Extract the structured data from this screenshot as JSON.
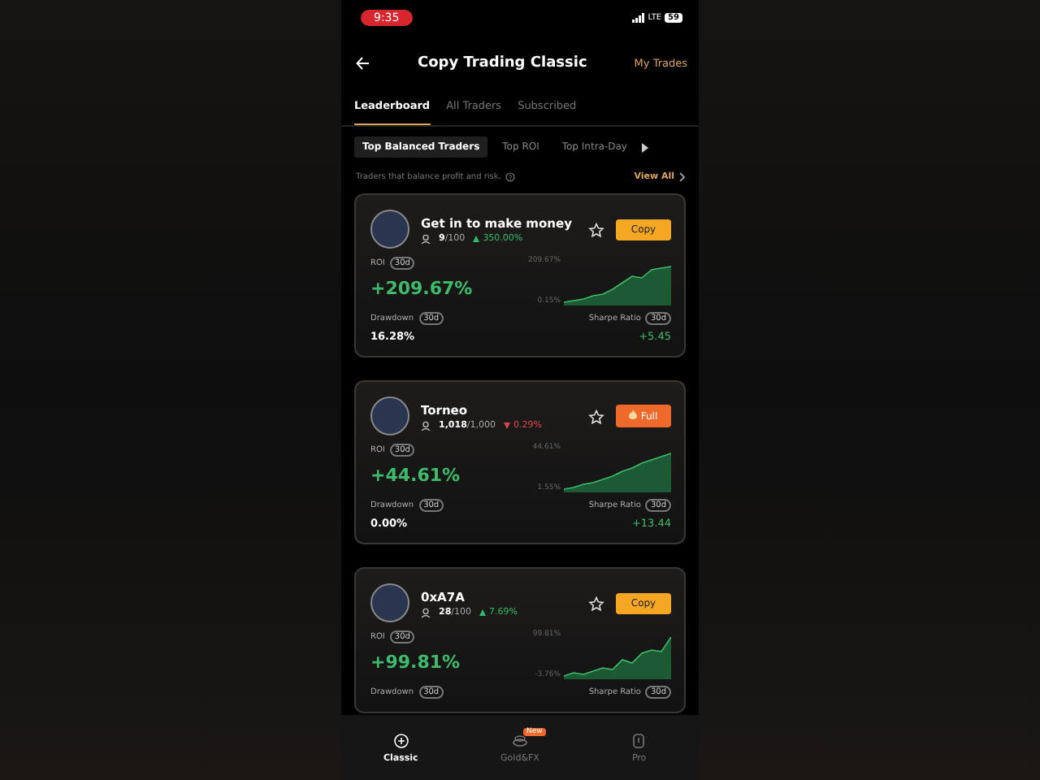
{
  "status_bar": {
    "time": "9:35",
    "network": "LTE",
    "battery": "59"
  },
  "header": {
    "title": "Copy Trading Classic",
    "action": "My Trades"
  },
  "tabs": [
    {
      "label": "Leaderboard",
      "selected": true
    },
    {
      "label": "All Traders",
      "selected": false
    },
    {
      "label": "Subscribed",
      "selected": false
    }
  ],
  "filters": [
    {
      "label": "Top Balanced Traders",
      "selected": true
    },
    {
      "label": "Top ROI",
      "selected": false
    },
    {
      "label": "Top Intra-Day",
      "selected": false
    }
  ],
  "section": {
    "description": "Traders that balance profit and risk.",
    "link": "View All"
  },
  "traders": [
    {
      "name": "Get in to make money",
      "followers": "9",
      "capacity": "/100",
      "change": "350.00%",
      "rising": true,
      "action": {
        "label": "Copy",
        "kind": "copy"
      },
      "roi_label": "ROI",
      "roi_period": "30d",
      "roi": "+209.67%",
      "chart_max": "209.67%",
      "chart_min": "0.15%",
      "drawdown_label": "Drawdown",
      "drawdown_period": "30d",
      "drawdown": "16.28%",
      "sharpe_label": "Sharpe Ratio",
      "sharpe_period": "30d",
      "sharpe": "+5.45"
    },
    {
      "name": "Torneo",
      "followers": "1,018",
      "capacity": "/1,000",
      "change": "0.29%",
      "rising": false,
      "action": {
        "label": "Full",
        "kind": "full"
      },
      "roi_label": "ROI",
      "roi_period": "30d",
      "roi": "+44.61%",
      "chart_max": "44.61%",
      "chart_min": "1.55%",
      "drawdown_label": "Drawdown",
      "drawdown_period": "30d",
      "drawdown": "0.00%",
      "sharpe_label": "Sharpe Ratio",
      "sharpe_period": "30d",
      "sharpe": "+13.44"
    },
    {
      "name": "0xA7A",
      "followers": "28",
      "capacity": "/100",
      "change": "7.69%",
      "rising": true,
      "action": {
        "label": "Copy",
        "kind": "copy"
      },
      "roi_label": "ROI",
      "roi_period": "30d",
      "roi": "+99.81%",
      "chart_max": "99.81%",
      "chart_min": "-3.76%",
      "drawdown_label": "Drawdown",
      "drawdown_period": "30d",
      "sharpe_label": "Sharpe Ratio",
      "sharpe_period": "30d"
    }
  ],
  "bottom_nav": [
    {
      "label": "Classic",
      "selected": true
    },
    {
      "label": "Gold&FX",
      "selected": false,
      "badge": "New"
    },
    {
      "label": "Pro",
      "selected": false
    }
  ]
}
